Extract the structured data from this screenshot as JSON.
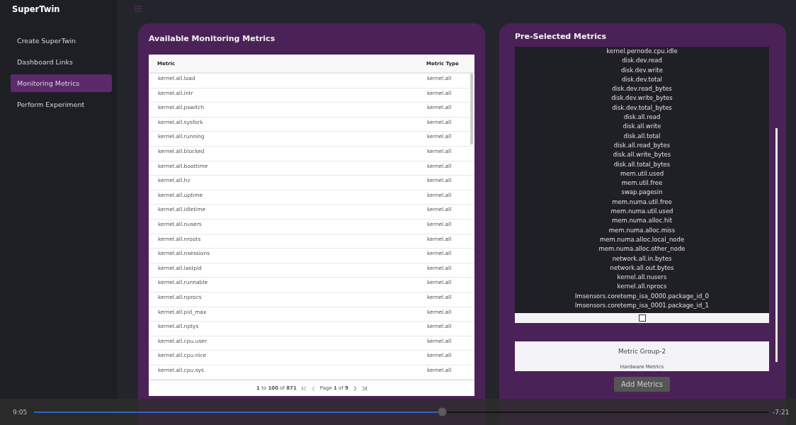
{
  "app": {
    "title": "SuperTwin"
  },
  "menu": [
    {
      "label": "Create SuperTwin",
      "selected": false
    },
    {
      "label": "Dashboard Links",
      "selected": false
    },
    {
      "label": "Monitoring Metrics",
      "selected": true
    },
    {
      "label": "Perform Experiment",
      "selected": false
    }
  ],
  "available_metrics": {
    "title": "Available Monitoring Metrics",
    "columns": [
      "Metric",
      "Metric Type"
    ],
    "rows": [
      [
        "kernel.all.load",
        "kernel.all"
      ],
      [
        "kernel.all.intr",
        "kernel.all"
      ],
      [
        "kernel.all.pswitch",
        "kernel.all"
      ],
      [
        "kernel.all.sysfork",
        "kernel.all"
      ],
      [
        "kernel.all.running",
        "kernel.all"
      ],
      [
        "kernel.all.blocked",
        "kernel.all"
      ],
      [
        "kernel.all.boottime",
        "kernel.all"
      ],
      [
        "kernel.all.hz",
        "kernel.all"
      ],
      [
        "kernel.all.uptime",
        "kernel.all"
      ],
      [
        "kernel.all.idletime",
        "kernel.all"
      ],
      [
        "kernel.all.nusers",
        "kernel.all"
      ],
      [
        "kernel.all.nroots",
        "kernel.all"
      ],
      [
        "kernel.all.nsessions",
        "kernel.all"
      ],
      [
        "kernel.all.lastpid",
        "kernel.all"
      ],
      [
        "kernel.all.runnable",
        "kernel.all"
      ],
      [
        "kernel.all.nprocs",
        "kernel.all"
      ],
      [
        "kernel.all.pid_max",
        "kernel.all"
      ],
      [
        "kernel.all.nptys",
        "kernel.all"
      ],
      [
        "kernel.all.cpu.user",
        "kernel.all"
      ],
      [
        "kernel.all.cpu.nice",
        "kernel.all"
      ],
      [
        "kernel.all.cpu.sys",
        "kernel.all"
      ]
    ],
    "pagination": {
      "range": "**1** to **100** of **871**",
      "page": "Page **1** of **9**"
    }
  },
  "preselected_metrics": {
    "title": "Pre-Selected Metrics",
    "items": [
      "kernel.pernode.cpu.idle",
      "disk.dev.read",
      "disk.dev.write",
      "disk.dev.total",
      "disk.dev.read_bytes",
      "disk.dev.write_bytes",
      "disk.dev.total_bytes",
      "disk.all.read",
      "disk.all.write",
      "disk.all.total",
      "disk.all.read_bytes",
      "disk.all.write_bytes",
      "disk.all.total_bytes",
      "mem.util.used",
      "mem.util.free",
      "swap.pagesin",
      "mem.numa.util.free",
      "mem.numa.util.used",
      "mem.numa.alloc.hit",
      "mem.numa.alloc.miss",
      "mem.numa.alloc.local_node",
      "mem.numa.alloc.other_node",
      "network.all.in.bytes",
      "network.all.out.bytes",
      "kernel.all.nusers",
      "kernel.all.nprocs",
      "lmsensors.coretemp_isa_0000.package_id_0",
      "lmsensors.coretemp_isa_0001.package_id_1"
    ],
    "checked": false,
    "group": {
      "title": "Metric Group-2",
      "subtitle": "Hardware Metrics"
    },
    "button": "Add Metrics"
  },
  "video_player": {
    "elapsed": "9:05",
    "remaining": "-7:21",
    "level": 0.555
  }
}
